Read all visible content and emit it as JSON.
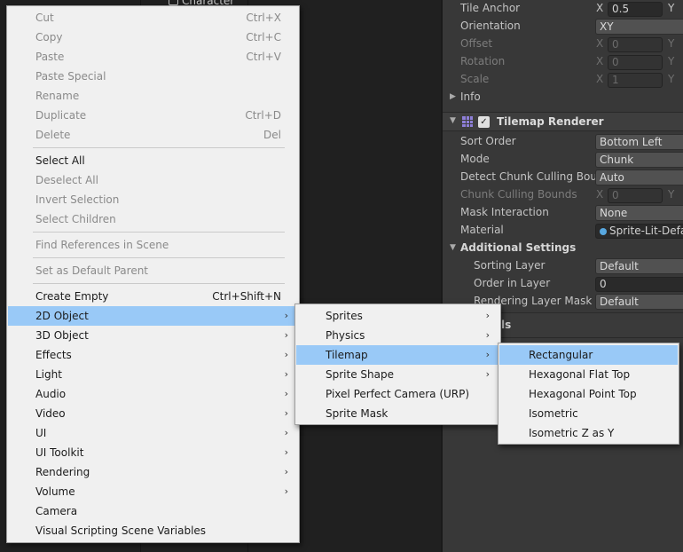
{
  "hierarchy": {
    "partial_item": "Character"
  },
  "inspector": {
    "rows": [
      {
        "label": "Tile Anchor",
        "x": "0.5",
        "y_label": "Y",
        "x_label": "X",
        "disabled": false
      },
      {
        "label": "Orientation",
        "value": "XY"
      },
      {
        "label": "Offset",
        "x": "0",
        "x_label": "X",
        "y_label": "Y",
        "disabled": true
      },
      {
        "label": "Rotation",
        "x": "0",
        "x_label": "X",
        "y_label": "Y",
        "disabled": true
      },
      {
        "label": "Scale",
        "x": "1",
        "x_label": "X",
        "y_label": "Y",
        "disabled": true
      },
      {
        "label": "Info"
      }
    ],
    "renderer": {
      "title": "Tilemap Renderer",
      "check": "✓",
      "fold": "▼",
      "sort_order_label": "Sort Order",
      "sort_order": "Bottom Left",
      "mode_label": "Mode",
      "mode": "Chunk",
      "detect_label": "Detect Chunk Culling Boun",
      "detect": "Auto",
      "bounds_label": "Chunk Culling Bounds",
      "bounds_x": "0",
      "bounds_x_label": "X",
      "bounds_y_label": "Y",
      "mask_label": "Mask Interaction",
      "mask": "None",
      "material_label": "Material",
      "material": "Sprite-Lit-Defa",
      "additional_label": "Additional Settings",
      "sorting_layer_label": "Sorting Layer",
      "sorting_layer": "Default",
      "order_label": "Order in Layer",
      "order": "0",
      "rlm_label": "Rendering Layer Mask",
      "rlm": "Default",
      "partial_label": "ls"
    },
    "info_fold": "▶"
  },
  "menus": {
    "main": [
      {
        "label": "Cut",
        "shortcut": "Ctrl+X",
        "disabled": true
      },
      {
        "label": "Copy",
        "shortcut": "Ctrl+C",
        "disabled": true
      },
      {
        "label": "Paste",
        "shortcut": "Ctrl+V",
        "disabled": true
      },
      {
        "label": "Paste Special",
        "disabled": true
      },
      {
        "label": "Rename",
        "disabled": true
      },
      {
        "label": "Duplicate",
        "shortcut": "Ctrl+D",
        "disabled": true
      },
      {
        "label": "Delete",
        "shortcut": "Del",
        "disabled": true
      },
      {
        "label": "Select All",
        "disabled": false
      },
      {
        "label": "Deselect All",
        "disabled": true
      },
      {
        "label": "Invert Selection",
        "disabled": true
      },
      {
        "label": "Select Children",
        "disabled": true
      },
      {
        "label": "Find References in Scene",
        "disabled": true
      },
      {
        "label": "Set as Default Parent",
        "disabled": true
      },
      {
        "label": "Create Empty",
        "shortcut": "Ctrl+Shift+N",
        "disabled": false
      },
      {
        "label": "2D Object",
        "submenu": true,
        "highlighted": true
      },
      {
        "label": "3D Object",
        "submenu": true
      },
      {
        "label": "Effects",
        "submenu": true
      },
      {
        "label": "Light",
        "submenu": true
      },
      {
        "label": "Audio",
        "submenu": true
      },
      {
        "label": "Video",
        "submenu": true
      },
      {
        "label": "UI",
        "submenu": true
      },
      {
        "label": "UI Toolkit",
        "submenu": true
      },
      {
        "label": "Rendering",
        "submenu": true
      },
      {
        "label": "Volume",
        "submenu": true
      },
      {
        "label": "Camera"
      },
      {
        "label": "Visual Scripting Scene Variables"
      }
    ],
    "object2d": [
      {
        "label": "Sprites",
        "submenu": true
      },
      {
        "label": "Physics",
        "submenu": true
      },
      {
        "label": "Tilemap",
        "submenu": true,
        "highlighted": true
      },
      {
        "label": "Sprite Shape",
        "submenu": true
      },
      {
        "label": "Pixel Perfect Camera (URP)"
      },
      {
        "label": "Sprite Mask"
      }
    ],
    "tilemap": [
      {
        "label": "Rectangular",
        "highlighted": true
      },
      {
        "label": "Hexagonal Flat Top"
      },
      {
        "label": "Hexagonal Point Top"
      },
      {
        "label": "Isometric"
      },
      {
        "label": "Isometric Z as Y"
      }
    ],
    "arrow_glyph": "›"
  },
  "colors": {
    "highlight": "#99c9f7",
    "menu_bg": "#f0f0f0",
    "inspector_bg": "#383838"
  }
}
